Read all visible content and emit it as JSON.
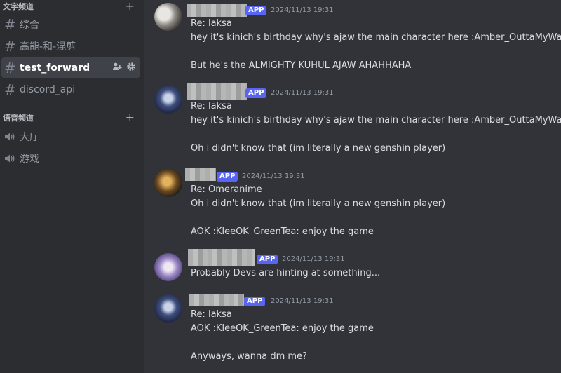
{
  "sidebar": {
    "text_category": "文字频道",
    "voice_category": "语音频道",
    "plus": "+",
    "text_channels": [
      {
        "name": "综合"
      },
      {
        "name": "高能-和-混剪"
      },
      {
        "name": "test_forward"
      },
      {
        "name": "discord_api"
      }
    ],
    "voice_channels": [
      {
        "name": "大厅"
      },
      {
        "name": "游戏"
      }
    ]
  },
  "colors": {
    "background": "#313338",
    "sidebar": "#2b2d31",
    "active_channel": "#404249",
    "app_badge": "#5865f2"
  },
  "messages": [
    {
      "badge": "APP",
      "timestamp": "2024/11/13 19:31",
      "lines": [
        "Re: laksa",
        "hey it's kinich's birthday why's ajaw the main character here :Amber_OuttaMyWay:",
        "",
        "But he's the ALMIGHTY KUHUL AJAW AHAHHAHA"
      ]
    },
    {
      "badge": "APP",
      "timestamp": "2024/11/13 19:31",
      "lines": [
        "Re: laksa",
        "hey it's kinich's birthday why's ajaw the main character here :Amber_OuttaMyWay:",
        "",
        "Oh i didn't know that (im literally a new genshin player)"
      ]
    },
    {
      "badge": "APP",
      "timestamp": "2024/11/13 19:31",
      "lines": [
        "Re: Omeranime",
        "Oh i didn't know that (im literally a new genshin player)",
        "",
        "AOK :KleeOK_GreenTea: enjoy the game"
      ]
    },
    {
      "badge": "APP",
      "timestamp": "2024/11/13 19:31",
      "lines": [
        "Probably Devs are hinting at something..."
      ]
    },
    {
      "badge": "APP",
      "timestamp": "2024/11/13 19:31",
      "lines": [
        "Re: laksa",
        "AOK :KleeOK_GreenTea: enjoy the game",
        "",
        "Anyways, wanna dm me?"
      ]
    }
  ]
}
